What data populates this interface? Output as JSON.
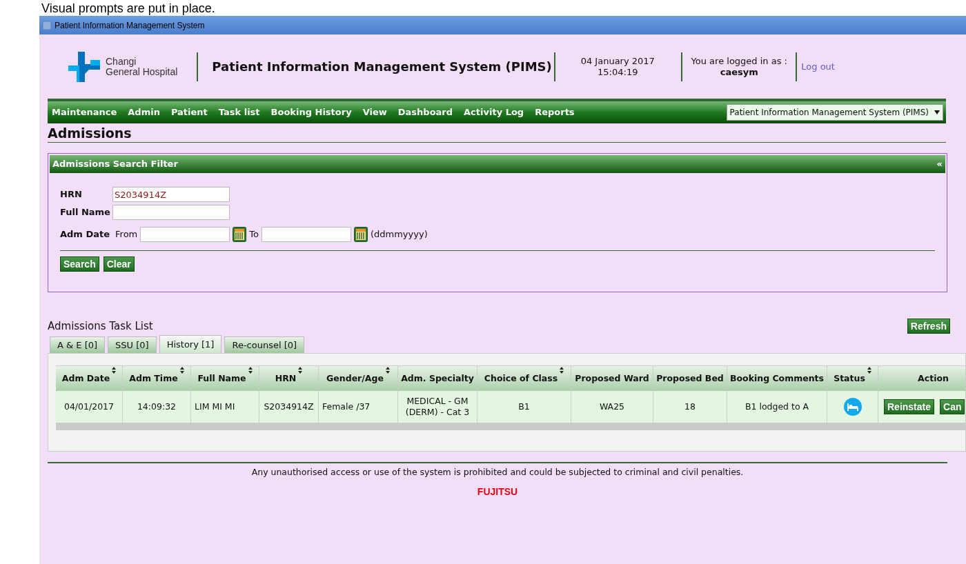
{
  "caption": "Visual prompts are put in place.",
  "window": {
    "title": "Patient Information Management System"
  },
  "header": {
    "logo_lines": [
      "Changi",
      "General Hospital"
    ],
    "app_title": "Patient Information Management System (PIMS)",
    "date": "04 January 2017",
    "time": "15:04:19",
    "login_label": "You are logged in as :",
    "user": "caesym",
    "logout": "Log out"
  },
  "menu": [
    "Maintenance",
    "Admin",
    "Patient",
    "Task list",
    "Booking History",
    "View",
    "Dashboard",
    "Activity Log",
    "Reports"
  ],
  "system_select": {
    "value": "Patient Information Management System (PIMS)"
  },
  "page_title": "Admissions",
  "filter": {
    "title": "Admissions Search Filter",
    "collapse": "«",
    "hrn_label": "HRN",
    "hrn_value": "S2034914Z",
    "name_label": "Full Name",
    "date_label": "Adm Date",
    "from_label": "From",
    "to_label": "To",
    "format_hint": "(ddmmyyyy)",
    "buttons": [
      "Search",
      "Clear"
    ]
  },
  "task_list": {
    "title": "Admissions Task List",
    "refresh": "Refresh",
    "tabs": [
      {
        "label": "A & E [0]",
        "selected": false
      },
      {
        "label": "SSU [0]",
        "selected": false
      },
      {
        "label": "History [1]",
        "selected": true
      },
      {
        "label": "Re-counsel [0]",
        "selected": false
      }
    ],
    "columns": [
      {
        "label": "Adm Date",
        "sortable": true
      },
      {
        "label": "Adm Time",
        "sortable": true
      },
      {
        "label": "Full Name",
        "sortable": true
      },
      {
        "label": "HRN",
        "sortable": true
      },
      {
        "label": "Gender/Age",
        "sortable": true
      },
      {
        "label": "Adm. Specialty",
        "sortable": false
      },
      {
        "label": "Choice of Class",
        "sortable": true
      },
      {
        "label": "Proposed Ward",
        "sortable": false
      },
      {
        "label": "Proposed Bed",
        "sortable": false
      },
      {
        "label": "Booking Comments",
        "sortable": false
      },
      {
        "label": "Status",
        "sortable": true
      },
      {
        "label": "Action",
        "sortable": false
      }
    ],
    "rows": [
      {
        "cells": [
          "04/01/2017",
          "14:09:32",
          "LIM MI MI",
          "S2034914Z",
          "Female /37",
          "MEDICAL - GM (DERM) - Cat 3",
          "B1",
          "WA25",
          "18",
          "B1 lodged to A"
        ],
        "actions": [
          "Reinstate",
          "Can"
        ]
      }
    ]
  },
  "footer": {
    "notice": "Any unauthorised access or use of the system is prohibited and could be subjected to criminal and civil penalties.",
    "logo": "FUJITSU"
  }
}
